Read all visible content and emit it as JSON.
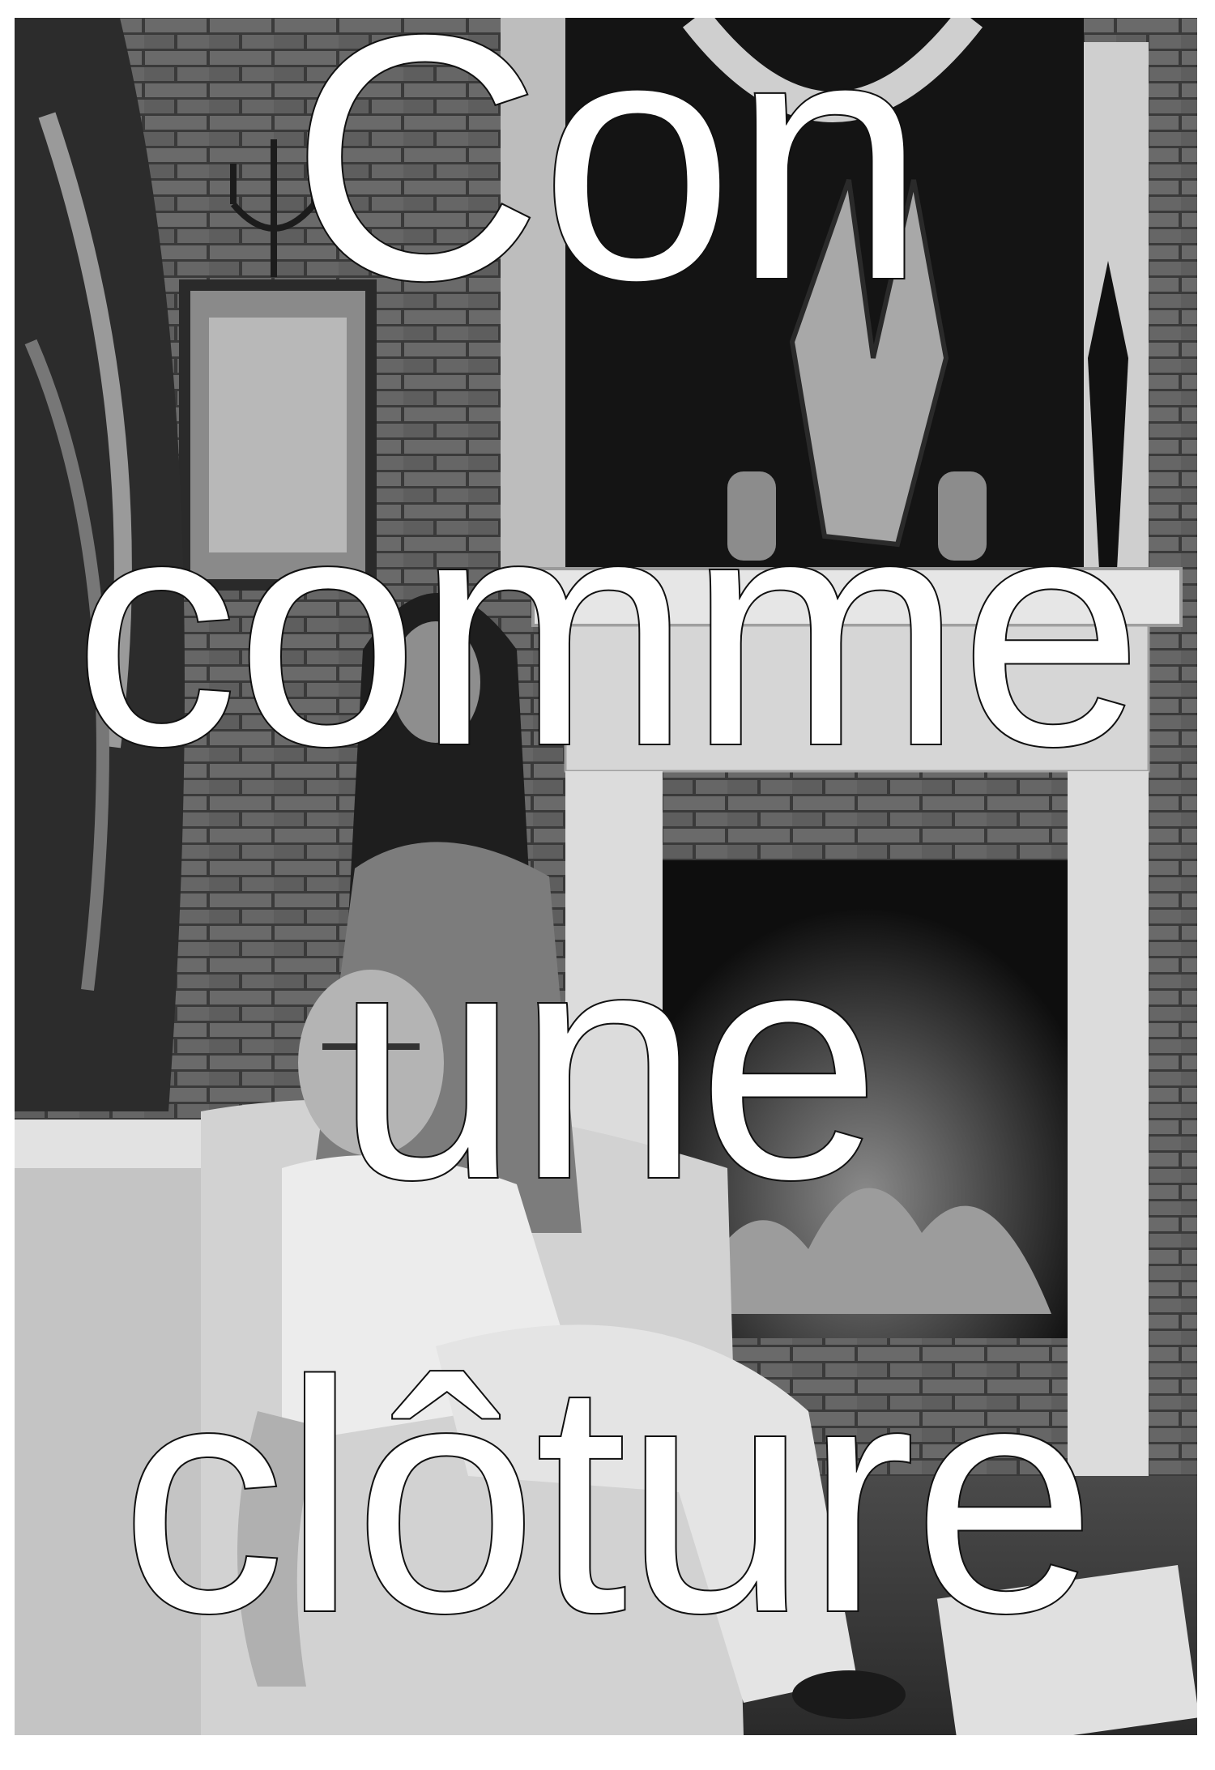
{
  "caption": {
    "lines": [
      "Con",
      "comme",
      "une",
      "clôture"
    ]
  },
  "photo": {
    "style": "grayscale",
    "colors": {
      "paper": "#ffffff",
      "dark": "#1a1a1a",
      "mid": "#6e6e6e",
      "light": "#d8d8d8"
    }
  }
}
